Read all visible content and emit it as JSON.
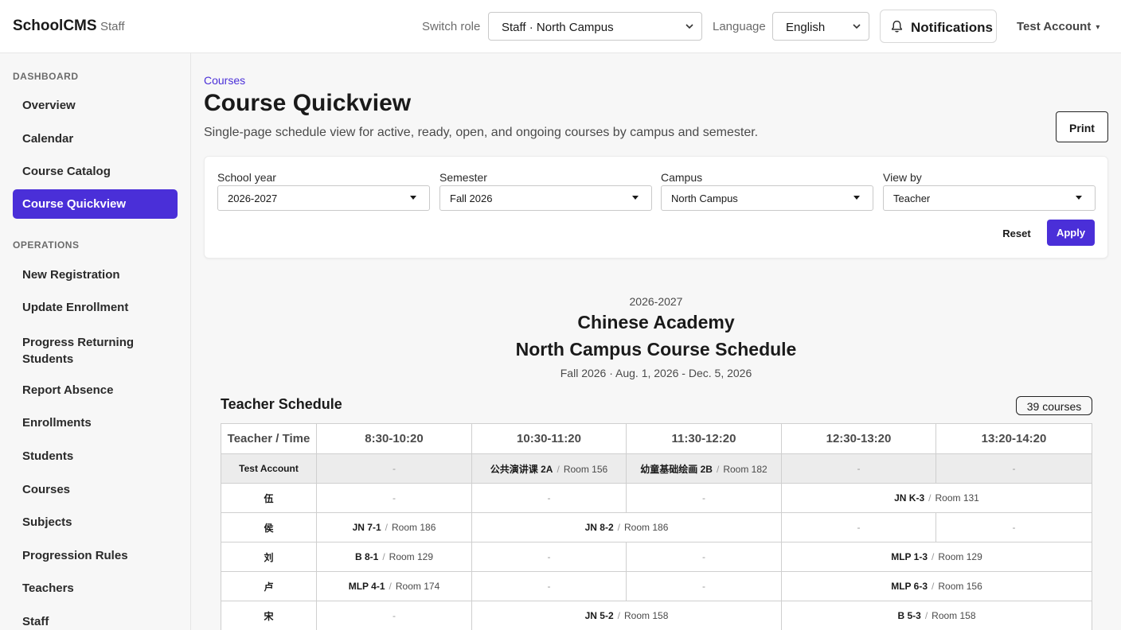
{
  "app": {
    "brand": "SchoolCMS",
    "brand_sub": "Staff",
    "switch_role_label": "Switch role",
    "role_value": "Staff · North Campus",
    "language_label": "Language",
    "language_value": "English",
    "notifications_label": "Notifications",
    "account_name": "Test Account",
    "account_caret": "▾",
    "accent_color": "#4a2fd8"
  },
  "sidebar": {
    "sections": [
      {
        "label": "DASHBOARD",
        "items": [
          {
            "label": "Overview"
          },
          {
            "label": "Calendar"
          },
          {
            "label": "Course Catalog"
          },
          {
            "label": "Course Quickview",
            "active": true
          }
        ]
      },
      {
        "label": "OPERATIONS",
        "items": [
          {
            "label": "New Registration"
          },
          {
            "label": "Update Enrollment"
          },
          {
            "label": "Progress Returning Students"
          },
          {
            "label": "Report Absence"
          },
          {
            "label": "Enrollments"
          },
          {
            "label": "Students"
          },
          {
            "label": "Courses"
          },
          {
            "label": "Subjects"
          },
          {
            "label": "Progression Rules"
          },
          {
            "label": "Teachers"
          },
          {
            "label": "Staff"
          }
        ]
      }
    ]
  },
  "page": {
    "breadcrumb": "Courses",
    "title": "Course Quickview",
    "description": "Single-page schedule view for active, ready, open, and ongoing courses by campus and semester.",
    "print_label": "Print"
  },
  "filters": {
    "school_year": {
      "label": "School year",
      "value": "2026-2027"
    },
    "semester": {
      "label": "Semester",
      "value": "Fall 2026"
    },
    "campus": {
      "label": "Campus",
      "value": "North Campus"
    },
    "view_by": {
      "label": "View by",
      "value": "Teacher"
    },
    "reset_label": "Reset",
    "apply_label": "Apply"
  },
  "schedule": {
    "year": "2026-2027",
    "school": "Chinese Academy",
    "campus_title": "North Campus Course Schedule",
    "term": "Fall 2026 · Aug. 1, 2026 - Dec. 5, 2026",
    "heading": "Teacher Schedule",
    "course_count": "39 courses",
    "columns": [
      "Teacher / Time",
      "8:30-10:20",
      "10:30-11:20",
      "11:30-12:20",
      "12:30-13:20",
      "13:20-14:20"
    ],
    "separator": "/",
    "empty": "-",
    "rows": [
      {
        "teacher": "Test Account",
        "highlight": true,
        "cells": [
          {
            "span": 1,
            "empty": true
          },
          {
            "span": 1,
            "code": "公共演讲课 2A",
            "room": "Room 156"
          },
          {
            "span": 1,
            "code": "幼童基础绘画 2B",
            "room": "Room 182"
          },
          {
            "span": 1,
            "empty": true
          },
          {
            "span": 1,
            "empty": true
          }
        ]
      },
      {
        "teacher": "伍",
        "cells": [
          {
            "span": 1,
            "empty": true
          },
          {
            "span": 1,
            "empty": true
          },
          {
            "span": 1,
            "empty": true
          },
          {
            "span": 2,
            "code": "JN K-3",
            "room": "Room 131"
          }
        ]
      },
      {
        "teacher": "侯",
        "cells": [
          {
            "span": 1,
            "code": "JN 7-1",
            "room": "Room 186"
          },
          {
            "span": 2,
            "code": "JN 8-2",
            "room": "Room 186"
          },
          {
            "span": 1,
            "empty": true
          },
          {
            "span": 1,
            "empty": true
          }
        ]
      },
      {
        "teacher": "刘",
        "cells": [
          {
            "span": 1,
            "code": "B 8-1",
            "room": "Room 129"
          },
          {
            "span": 1,
            "empty": true
          },
          {
            "span": 1,
            "empty": true
          },
          {
            "span": 2,
            "code": "MLP 1-3",
            "room": "Room 129"
          }
        ]
      },
      {
        "teacher": "卢",
        "cells": [
          {
            "span": 1,
            "code": "MLP 4-1",
            "room": "Room 174"
          },
          {
            "span": 1,
            "empty": true
          },
          {
            "span": 1,
            "empty": true
          },
          {
            "span": 2,
            "code": "MLP 6-3",
            "room": "Room 156"
          }
        ]
      },
      {
        "teacher": "宋",
        "cells": [
          {
            "span": 1,
            "empty": true
          },
          {
            "span": 2,
            "code": "JN 5-2",
            "room": "Room 158"
          },
          {
            "span": 2,
            "code": "B 5-3",
            "room": "Room 158"
          }
        ]
      }
    ]
  }
}
